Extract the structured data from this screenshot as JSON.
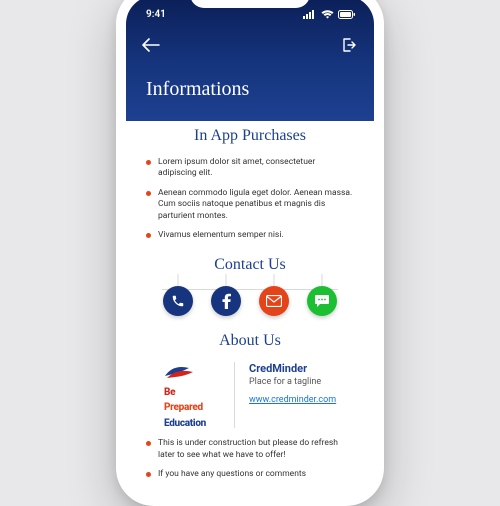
{
  "status": {
    "time": "9:41"
  },
  "header": {
    "title": "Informations"
  },
  "purchases": {
    "title": "In App Purchases",
    "items": [
      "Lorem ipsum dolor sit amet, consectetuer adipiscing elit.",
      "Aenean commodo ligula eget dolor. Aenean massa. Cum sociis natoque penatibus et magnis dis parturient montes.",
      "Vivamus elementum semper nisi."
    ]
  },
  "contact": {
    "title": "Contact Us"
  },
  "about": {
    "title": "About Us",
    "brand": "CredMinder",
    "tagline": "Place for a tagline",
    "link": "www.credminder.com",
    "logo_l1": "Be",
    "logo_l2": "Prepared",
    "logo_l3": "Education",
    "items": [
      "This is under construction but please do refresh later to see what we have to offer!",
      "If you have any questions or comments"
    ]
  }
}
